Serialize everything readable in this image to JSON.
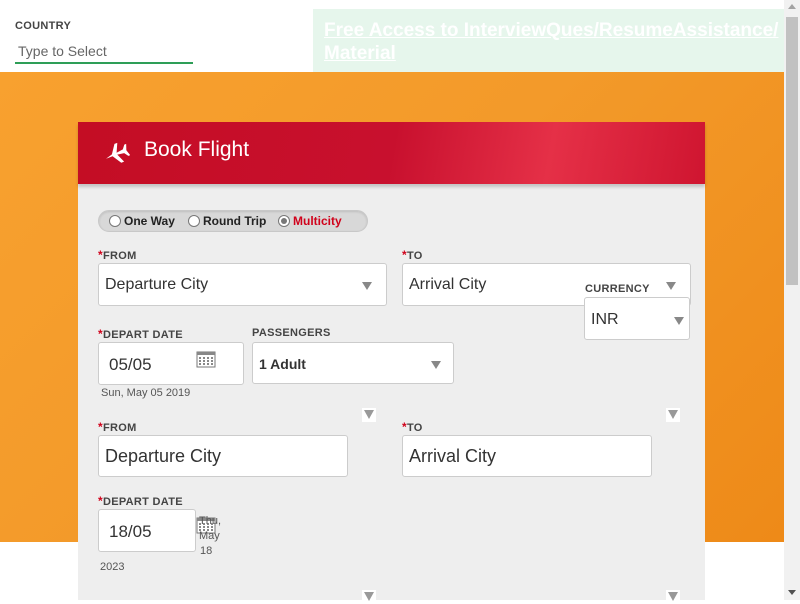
{
  "topbar": {
    "country_label": "COUNTRY",
    "country_placeholder": "Type to Select",
    "promo_link": "Free Access to InterviewQues/ResumeAssistance/Material"
  },
  "booking": {
    "title": "Book Flight",
    "trip_types": [
      "One Way",
      "Round Trip",
      "Multicity"
    ],
    "selected_trip_type": "Multicity",
    "segment1": {
      "from_label": "FROM",
      "from_value": "Departure City",
      "to_label": "TO",
      "to_value": "Arrival City",
      "depart_label": "DEPART DATE",
      "depart_value": "05/05",
      "depart_full": "Sun, May 05 2019"
    },
    "currency": {
      "label": "CURRENCY",
      "value": "INR"
    },
    "passengers": {
      "label": "PASSENGERS",
      "value": "1 Adult"
    },
    "segment2": {
      "from_label": "FROM",
      "from_value": "Departure City",
      "to_label": "TO",
      "to_value": "Arrival City",
      "depart_label": "DEPART DATE",
      "depart_value": "18/05",
      "depart_day": "Thu,",
      "depart_month": "May",
      "depart_date": "18",
      "depart_year": "2023"
    }
  },
  "colors": {
    "brand_red": "#c8102e",
    "hero_orange": "#f39a2a",
    "promo_bg": "#e6f6ec",
    "input_underline": "#2e9e57"
  }
}
